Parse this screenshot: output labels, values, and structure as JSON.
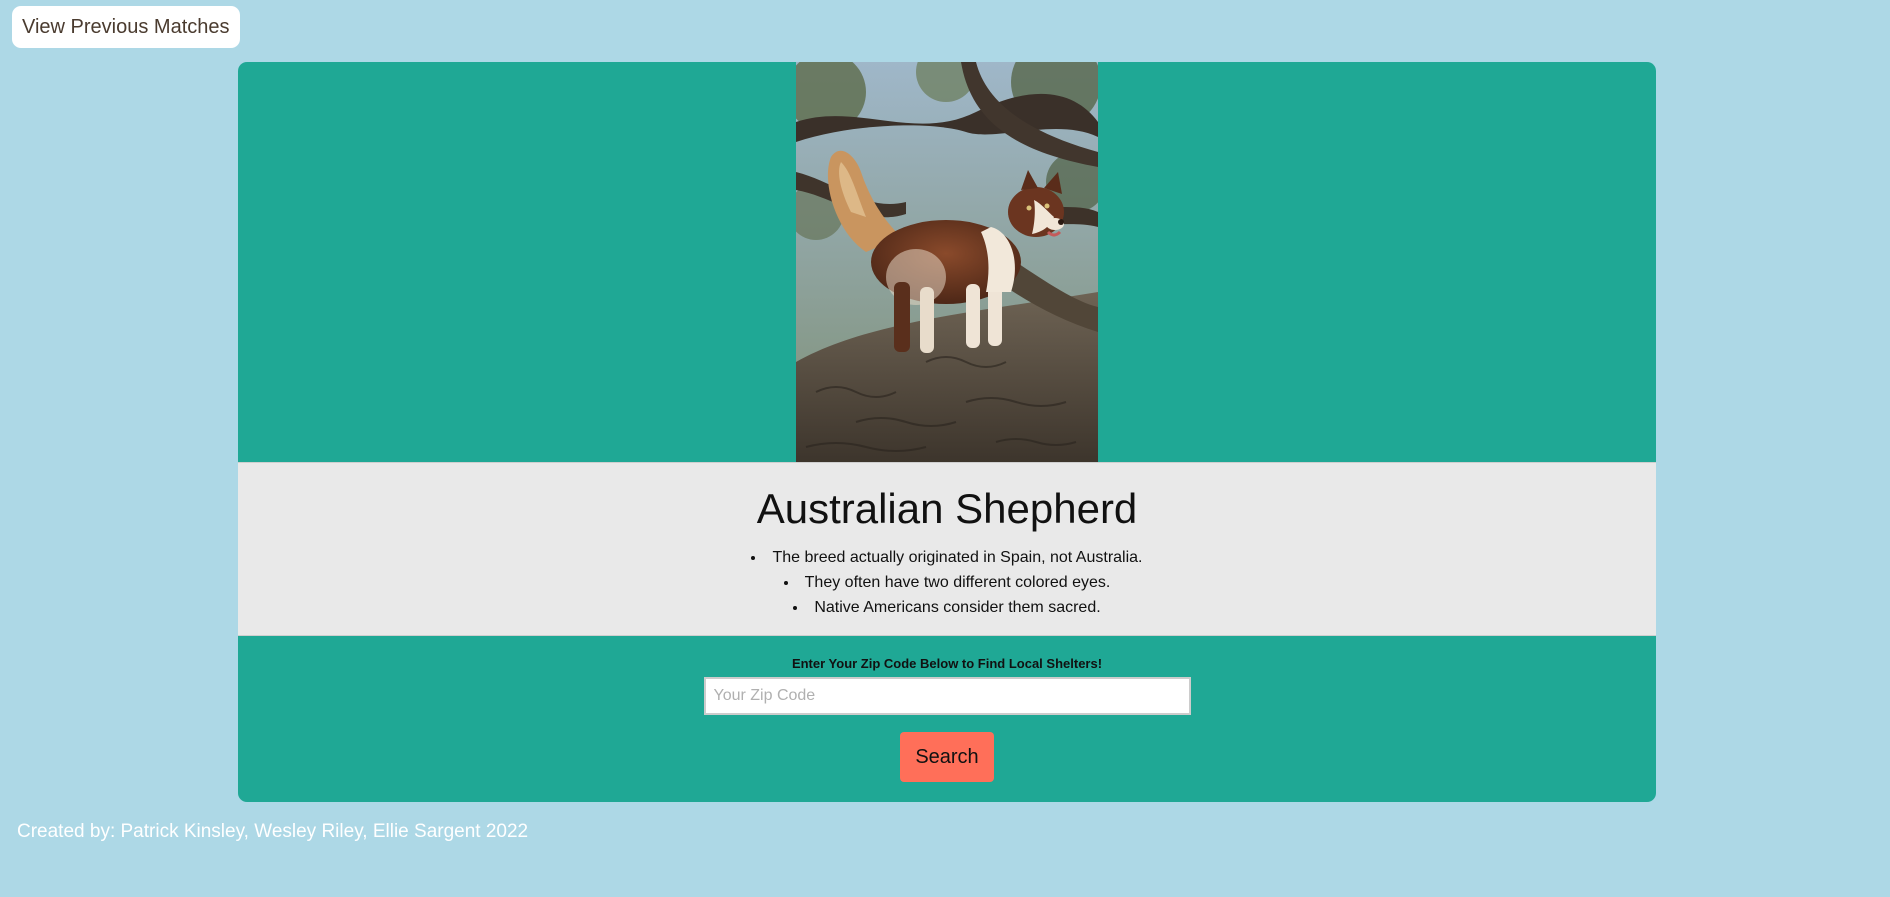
{
  "nav": {
    "previous_matches_label": "View Previous Matches"
  },
  "result": {
    "breed_name": "Australian Shepherd",
    "photo_icon": "dog-photo",
    "facts": [
      "The breed actually originated in Spain, not Australia.",
      "They often have two different colored eyes.",
      "Native Americans consider them sacred."
    ]
  },
  "search": {
    "label": "Enter Your Zip Code Below to Find Local Shelters!",
    "placeholder": "Your Zip Code",
    "value": "",
    "button_label": "Search"
  },
  "footer": {
    "credits": "Created by: Patrick Kinsley, Wesley Riley, Ellie Sargent 2022"
  },
  "colors": {
    "page_background": "#add8e6",
    "card_background": "#1fa895",
    "info_background": "#e9e9e9",
    "search_button": "#ff6f59"
  }
}
